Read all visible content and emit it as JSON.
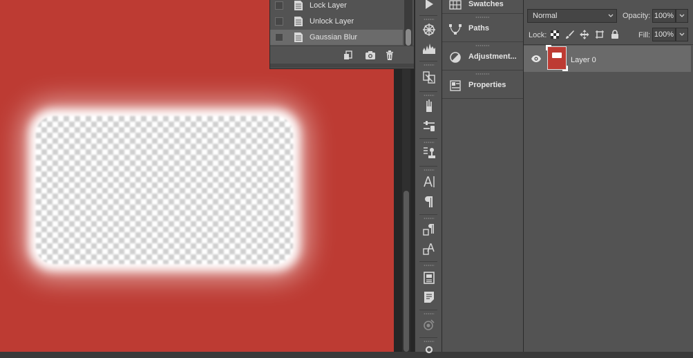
{
  "history": {
    "items": [
      {
        "label": "Lock Layer",
        "selected": false
      },
      {
        "label": "Unlock Layer",
        "selected": false
      },
      {
        "label": "Gaussian Blur",
        "selected": true
      }
    ],
    "footer_icons": [
      "new-document-from-state-icon",
      "camera-snapshot-icon",
      "trash-icon"
    ]
  },
  "icon_strip": [
    "play-icon",
    "color-wheel-icon",
    "histogram-icon",
    "clone-source-icon",
    "brush-icon",
    "brush-settings-icon",
    "tool-presets-icon",
    "character-icon",
    "paragraph-icon",
    "paragraph-styles-icon",
    "character-styles-icon",
    "notes-icon",
    "note-icon",
    "3d-icon",
    "measure-icon"
  ],
  "mid_panels": [
    {
      "label": "Swatches",
      "icon": "swatches-icon"
    },
    {
      "label": "Paths",
      "icon": "paths-icon"
    },
    {
      "label": "Adjustment...",
      "icon": "adjustments-icon"
    },
    {
      "label": "Properties",
      "icon": "properties-icon"
    }
  ],
  "layers": {
    "blend_mode": "Normal",
    "opacity_label": "Opacity:",
    "opacity_value": "100%",
    "lock_label": "Lock:",
    "fill_label": "Fill:",
    "fill_value": "100%",
    "layer_name": "Layer 0"
  },
  "colors": {
    "canvas_red": "#bd3b33",
    "panel_bg": "#535353",
    "selected_row": "#6b6b6b"
  }
}
